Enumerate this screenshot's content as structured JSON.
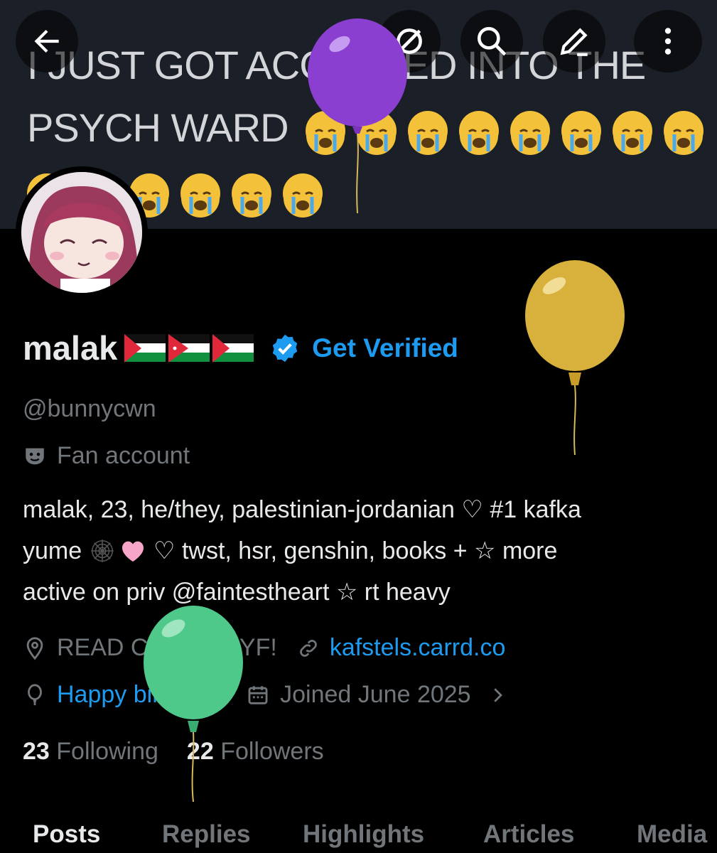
{
  "header": {
    "banner_text_line1": "I JUST GOT ACCEPTED INTO THE",
    "banner_text_line2": "PSYCH WARD",
    "emoji_name": "loudly-crying-face"
  },
  "profile": {
    "name": "malak",
    "flags": [
      "palestine-flag",
      "jordan-flag",
      "palestine-flag"
    ],
    "get_verified_label": "Get Verified",
    "handle": "@bunnycwn",
    "category": "Fan account",
    "bio_line1": "malak, 23, he/they, palestinian-jordanian ♡ #1 kafka",
    "bio_line2a": "yume ",
    "bio_line2b": " ♡ twst, hsr, genshin, books + ☆ more",
    "bio_line3": "active on priv @faintestheart ☆ rt heavy",
    "location": "READ CARRD BYF!",
    "website": "kafstels.carrd.co",
    "birthday": "Happy birthday!",
    "joined": "Joined June 2025",
    "following_count": "23",
    "following_label": "Following",
    "followers_count": "22",
    "followers_label": "Followers"
  },
  "tabs": [
    {
      "label": "Posts",
      "active": true
    },
    {
      "label": "Replies"
    },
    {
      "label": "Highlights"
    },
    {
      "label": "Articles"
    },
    {
      "label": "Media"
    }
  ],
  "colors": {
    "accent": "#1d9bf0",
    "muted": "#71767b",
    "balloon_purple": "#8a3fd0",
    "balloon_gold": "#d7b13b",
    "balloon_green": "#4fc98a"
  }
}
